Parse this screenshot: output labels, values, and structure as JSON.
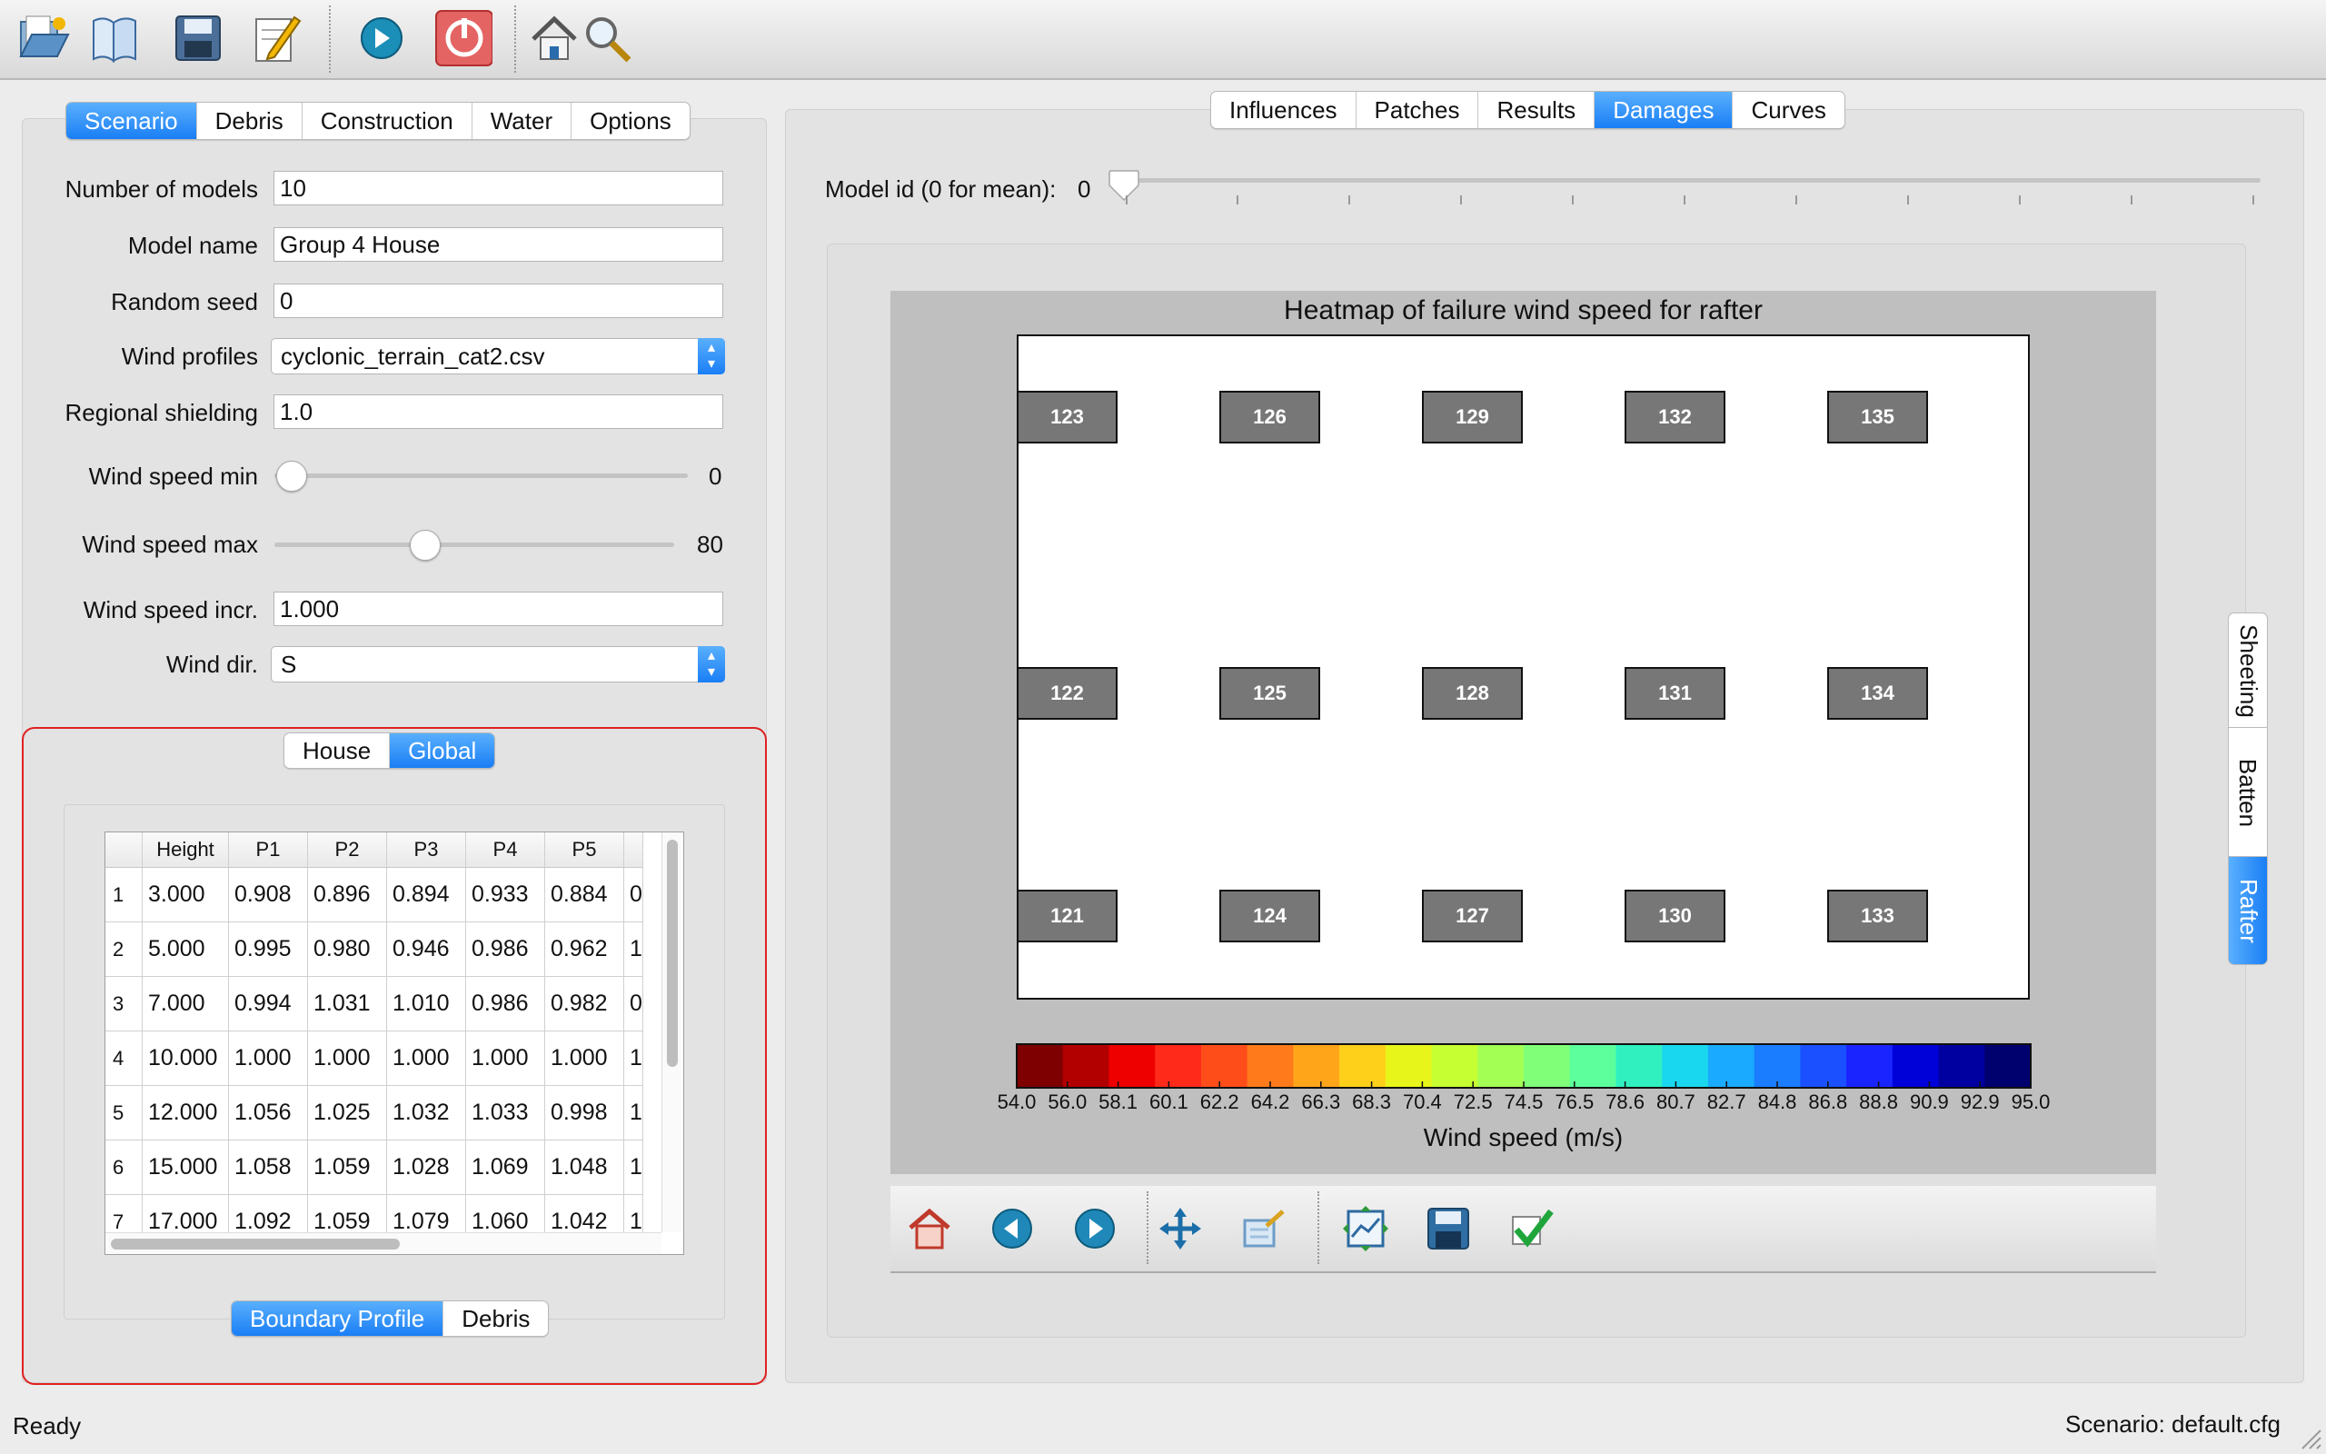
{
  "toolbar": {
    "icons": [
      "open-icon",
      "book-icon",
      "save-icon",
      "edit-icon",
      "run-icon",
      "stop-icon",
      "home-icon",
      "search-icon"
    ]
  },
  "left_tabs": [
    "Scenario",
    "Debris",
    "Construction",
    "Water",
    "Options"
  ],
  "left_tabs_active": "Scenario",
  "form": {
    "num_models_label": "Number of models",
    "num_models": "10",
    "model_name_label": "Model name",
    "model_name": "Group 4 House",
    "seed_label": "Random seed",
    "seed": "0",
    "wind_profiles_label": "Wind profiles",
    "wind_profiles": "cyclonic_terrain_cat2.csv",
    "shielding_label": "Regional shielding",
    "shielding": "1.0",
    "ws_min_label": "Wind speed min",
    "ws_min": "0",
    "ws_max_label": "Wind speed max",
    "ws_max": "80",
    "ws_incr_label": "Wind speed incr.",
    "ws_incr": "1.000",
    "wind_dir_label": "Wind dir.",
    "wind_dir": "S"
  },
  "group_tabs": [
    "House",
    "Global"
  ],
  "group_tabs_active": "Global",
  "table": {
    "columns": [
      "Height",
      "P1",
      "P2",
      "P3",
      "P4",
      "P5"
    ],
    "rows": [
      {
        "n": "1",
        "height": "3.000",
        "p": [
          "0.908",
          "0.896",
          "0.894",
          "0.933",
          "0.884"
        ],
        "next": "0"
      },
      {
        "n": "2",
        "height": "5.000",
        "p": [
          "0.995",
          "0.980",
          "0.946",
          "0.986",
          "0.962"
        ],
        "next": "1"
      },
      {
        "n": "3",
        "height": "7.000",
        "p": [
          "0.994",
          "1.031",
          "1.010",
          "0.986",
          "0.982"
        ],
        "next": "0"
      },
      {
        "n": "4",
        "height": "10.000",
        "p": [
          "1.000",
          "1.000",
          "1.000",
          "1.000",
          "1.000"
        ],
        "next": "1"
      },
      {
        "n": "5",
        "height": "12.000",
        "p": [
          "1.056",
          "1.025",
          "1.032",
          "1.033",
          "0.998"
        ],
        "next": "1"
      },
      {
        "n": "6",
        "height": "15.000",
        "p": [
          "1.058",
          "1.059",
          "1.028",
          "1.069",
          "1.048"
        ],
        "next": "1"
      },
      {
        "n": "7",
        "height": "17.000",
        "p": [
          "1.092",
          "1.059",
          "1.079",
          "1.060",
          "1.042"
        ],
        "next": "1"
      }
    ]
  },
  "bottom_tabs": [
    "Boundary Profile",
    "Debris"
  ],
  "bottom_tabs_active": "Boundary Profile",
  "right_tabs": [
    "Influences",
    "Patches",
    "Results",
    "Damages",
    "Curves"
  ],
  "right_tabs_active": "Damages",
  "model_id": {
    "label": "Model id (0 for mean):",
    "value": "0"
  },
  "side_tabs": [
    "Sheeting",
    "Batten",
    "Rafter"
  ],
  "side_tabs_active": "Rafter",
  "chart_data": {
    "type": "heatmap",
    "title": "Heatmap of failure wind speed for rafter",
    "cells_rows": [
      [
        "123",
        "126",
        "129",
        "132",
        "135"
      ],
      [
        "122",
        "125",
        "128",
        "131",
        "134"
      ],
      [
        "121",
        "124",
        "127",
        "130",
        "133"
      ]
    ],
    "colorbar": {
      "label": "Wind speed (m/s)",
      "ticks": [
        "54.0",
        "56.0",
        "58.1",
        "60.1",
        "62.2",
        "64.2",
        "66.3",
        "68.3",
        "70.4",
        "72.5",
        "74.5",
        "76.5",
        "78.6",
        "80.7",
        "82.7",
        "84.8",
        "86.8",
        "88.8",
        "90.9",
        "92.9",
        "95.0"
      ],
      "colors": [
        "#7f0000",
        "#b20000",
        "#ee0000",
        "#ff2a1a",
        "#ff4d1a",
        "#ff7a1a",
        "#ffa51a",
        "#ffd01a",
        "#e8f51a",
        "#c6ff32",
        "#a4ff55",
        "#80ff78",
        "#5cff9c",
        "#30f0c0",
        "#1ad7f0",
        "#1aaaff",
        "#1a7dff",
        "#1a50ff",
        "#1a24ff",
        "#0000d8",
        "#0000a0",
        "#00006e"
      ]
    }
  },
  "nav_icons": [
    "home-icon",
    "back-icon",
    "forward-icon",
    "pan-icon",
    "zoom-icon",
    "subplots-icon",
    "save-icon",
    "check-icon"
  ],
  "status": {
    "left": "Ready",
    "right": "Scenario: default.cfg"
  }
}
